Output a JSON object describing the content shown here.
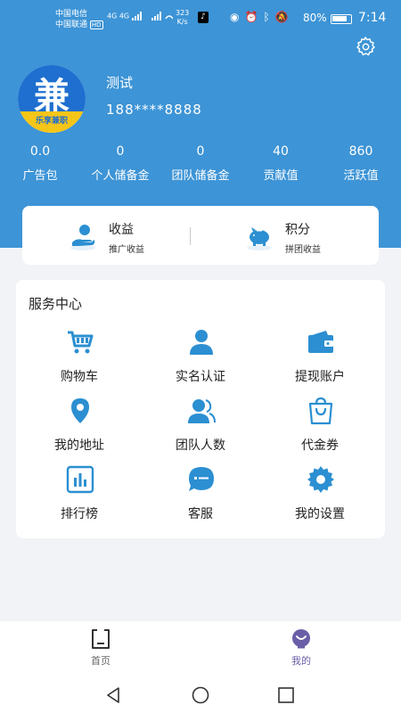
{
  "status_bar": {
    "carrier_1": "中国电信",
    "carrier_2": "中国联通",
    "hd_badge": "HD",
    "network": "4G 4G",
    "speed_value": "323",
    "speed_unit": "K/s",
    "battery": "80%",
    "time": "7:14",
    "icons": [
      "tiktok-icon",
      "eye-icon",
      "alarm-icon",
      "bluetooth-icon",
      "mute-icon"
    ]
  },
  "profile": {
    "name": "测试",
    "phone": "188****8888",
    "avatar_char": "兼",
    "avatar_text": "乐享兼职"
  },
  "stats": [
    {
      "value": "0.0",
      "label": "广告包"
    },
    {
      "value": "0",
      "label": "个人储备金"
    },
    {
      "value": "0",
      "label": "团队储备金"
    },
    {
      "value": "40",
      "label": "贡献值"
    },
    {
      "value": "860",
      "label": "活跃值"
    }
  ],
  "earnings": [
    {
      "title": "收益",
      "subtitle": "推广收益",
      "icon": "hand-coin-icon"
    },
    {
      "title": "积分",
      "subtitle": "拼团收益",
      "icon": "piggy-bank-icon"
    }
  ],
  "service_center": {
    "title": "服务中心",
    "items": [
      {
        "label": "购物车",
        "icon": "cart-icon"
      },
      {
        "label": "实名认证",
        "icon": "person-icon"
      },
      {
        "label": "提现账户",
        "icon": "wallet-icon"
      },
      {
        "label": "我的地址",
        "icon": "location-icon"
      },
      {
        "label": "团队人数",
        "icon": "team-icon"
      },
      {
        "label": "代金券",
        "icon": "shopping-bag-icon"
      },
      {
        "label": "排行榜",
        "icon": "bar-chart-icon"
      },
      {
        "label": "客服",
        "icon": "chat-icon"
      },
      {
        "label": "我的设置",
        "icon": "settings-icon"
      }
    ]
  },
  "bottom_nav": {
    "items": [
      {
        "label": "首页",
        "icon": "home-icon",
        "active": false
      },
      {
        "label": "我的",
        "icon": "profile-icon",
        "active": true
      }
    ]
  },
  "colors": {
    "header_blue": "#3d94d6",
    "icon_blue": "#2b8fd1",
    "nav_active": "#6b5ea8",
    "nav_inactive": "#666666"
  }
}
